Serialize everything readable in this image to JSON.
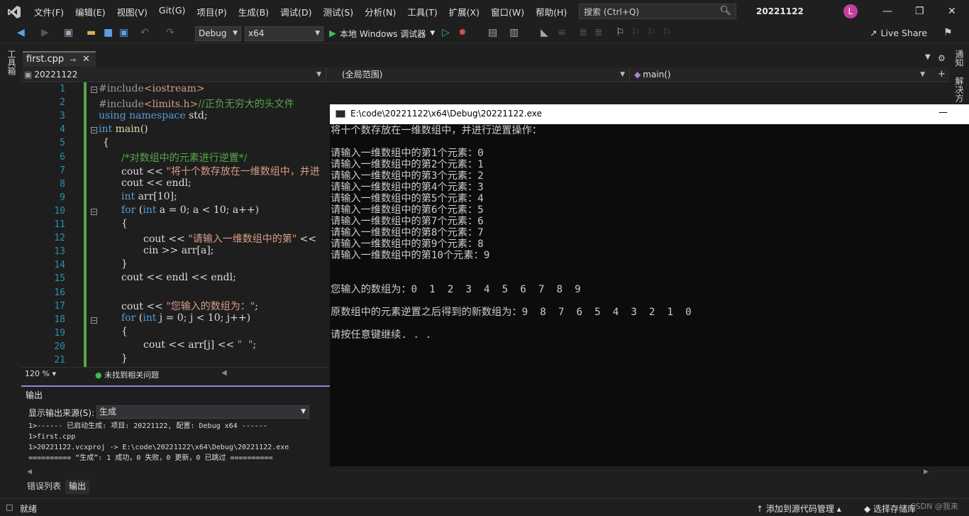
{
  "menu": {
    "items": [
      "文件(F)",
      "编辑(E)",
      "视图(V)",
      "Git(G)",
      "项目(P)",
      "生成(B)",
      "调试(D)",
      "测试(S)",
      "分析(N)",
      "工具(T)",
      "扩展(X)",
      "窗口(W)",
      "帮助(H)"
    ],
    "search_placeholder": "搜索 (Ctrl+Q)",
    "solution_title": "20221122",
    "avatar_letter": "L"
  },
  "toolbar": {
    "config": "Debug",
    "platform": "x64",
    "run_label": "本地 Windows 调试器",
    "live_share": "Live Share"
  },
  "side": {
    "toolbox": "工具箱",
    "notifications": "通知",
    "solution_explorer": "解决方"
  },
  "editor": {
    "tab_name": "first.cpp",
    "nav_project": "20221122",
    "nav_scope": "(全局范围)",
    "nav_function": "main()",
    "line_numbers": [
      "1",
      "2",
      "3",
      "4",
      "5",
      "6",
      "7",
      "8",
      "9",
      "10",
      "11",
      "12",
      "13",
      "14",
      "15",
      "16",
      "17",
      "18",
      "19",
      "20",
      "21"
    ],
    "zoom": "120 %",
    "issues": "未找到相关问题"
  },
  "code": {
    "l1_pp": "#include",
    "l1_inc": "<iostream>",
    "l2_pp": "#include",
    "l2_inc": "<limits.h>",
    "l2_cm": "//正负无穷大的头文件",
    "l3_kw1": "using",
    "l3_kw2": "namespace",
    "l3_rest": " std;",
    "l4_kw": "int",
    "l4_fn": "main",
    "l4_rest": "()",
    "l5": "{",
    "l6_cm": "/*对数组中的元素进行逆置*/",
    "l7_a": "cout << ",
    "l7_str": "\"将十个数存放在一维数组中，并进",
    "l8": "cout << endl;",
    "l9_kw": "int",
    "l9_rest": " arr[10];",
    "l10_kw": "for",
    "l10_a": " (",
    "l10_kw2": "int",
    "l10_rest": " a = 0; a < 10; a++)",
    "l11": "{",
    "l12_a": "cout << ",
    "l12_str": "\"请输入一维数组中的第\"",
    "l12_rest": " <<",
    "l13": "cin >> arr[a];",
    "l14": "}",
    "l15": "cout << endl << endl;",
    "l17_a": "cout << ",
    "l17_str": "\"您输入的数组为：\"",
    "l17_rest": ";",
    "l18_kw": "for",
    "l18_a": " (",
    "l18_kw2": "int",
    "l18_rest": " j = 0; j < 10; j++)",
    "l19": "{",
    "l20_a": "cout << arr[j] << ",
    "l20_str": "\"  \"",
    "l20_rest": ";",
    "l21": "}"
  },
  "output": {
    "title": "输出",
    "source_label": "显示输出来源(S):",
    "source_value": "生成",
    "lines": [
      "1>------ 已启动生成: 项目: 20221122, 配置: Debug x64 ------",
      "1>first.cpp",
      "1>20221122.vcxproj -> E:\\code\\20221122\\x64\\Debug\\20221122.exe",
      "========== “生成”: 1 成功，0 失败，0 更新，0 已跳过 =========="
    ]
  },
  "bottom_tabs": [
    "错误列表",
    "输出"
  ],
  "status": {
    "ready": "就绪",
    "source_control": "添加到源代码管理",
    "repo": "选择存储库"
  },
  "console": {
    "title": "E:\\code\\20221122\\x64\\Debug\\20221122.exe",
    "lines": [
      "将十个数存放在一维数组中，并进行逆置操作：",
      "",
      "请输入一维数组中的第1个元素：0",
      "请输入一维数组中的第2个元素：1",
      "请输入一维数组中的第3个元素：2",
      "请输入一维数组中的第4个元素：3",
      "请输入一维数组中的第5个元素：4",
      "请输入一维数组中的第6个元素：5",
      "请输入一维数组中的第7个元素：6",
      "请输入一维数组中的第8个元素：7",
      "请输入一维数组中的第9个元素：8",
      "请输入一维数组中的第10个元素：9",
      "",
      "",
      "您输入的数组为：0  1  2  3  4  5  6  7  8  9",
      "",
      "原数组中的元素逆置之后得到的新数组为：9  8  7  6  5  4  3  2  1  0",
      "",
      "请按任意键继续. . ."
    ]
  },
  "watermark": "CSDN @我来"
}
